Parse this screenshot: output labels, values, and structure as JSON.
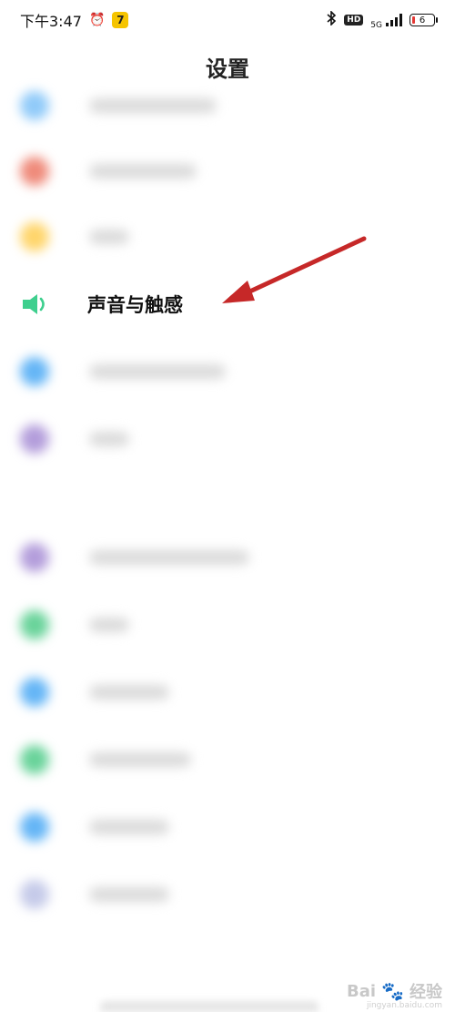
{
  "status_bar": {
    "time": "下午3:47",
    "app_badge": "7",
    "network": "5G",
    "hd": "HD",
    "battery": "6",
    "icons": [
      "alarm-icon",
      "app-badge-icon",
      "bluetooth-icon",
      "hd-icon",
      "signal-icon",
      "battery-icon"
    ]
  },
  "page": {
    "title": "设置"
  },
  "settings": {
    "sound_item": {
      "label": "声音与触感",
      "icon": "speaker-icon",
      "icon_color": "#3ecf8e"
    },
    "blurred_items": [
      {
        "icon_color": "#90caf9"
      },
      {
        "icon_color": "#ef8a7a"
      },
      {
        "icon_color": "#ffd56b"
      },
      {
        "icon_color": "#64b5f6"
      },
      {
        "icon_color": "#b39ddb"
      },
      {
        "icon_color": "#b39ddb"
      },
      {
        "icon_color": "#69d39a"
      },
      {
        "icon_color": "#64b5f6"
      },
      {
        "icon_color": "#69d39a"
      },
      {
        "icon_color": "#64b5f6"
      },
      {
        "icon_color": "#c5cae9"
      }
    ]
  },
  "annotation": {
    "arrow_color": "#c62828"
  },
  "watermark": {
    "brand": "Bai",
    "brand_cn": "经验",
    "domain": "jingyan.baidu.com"
  }
}
